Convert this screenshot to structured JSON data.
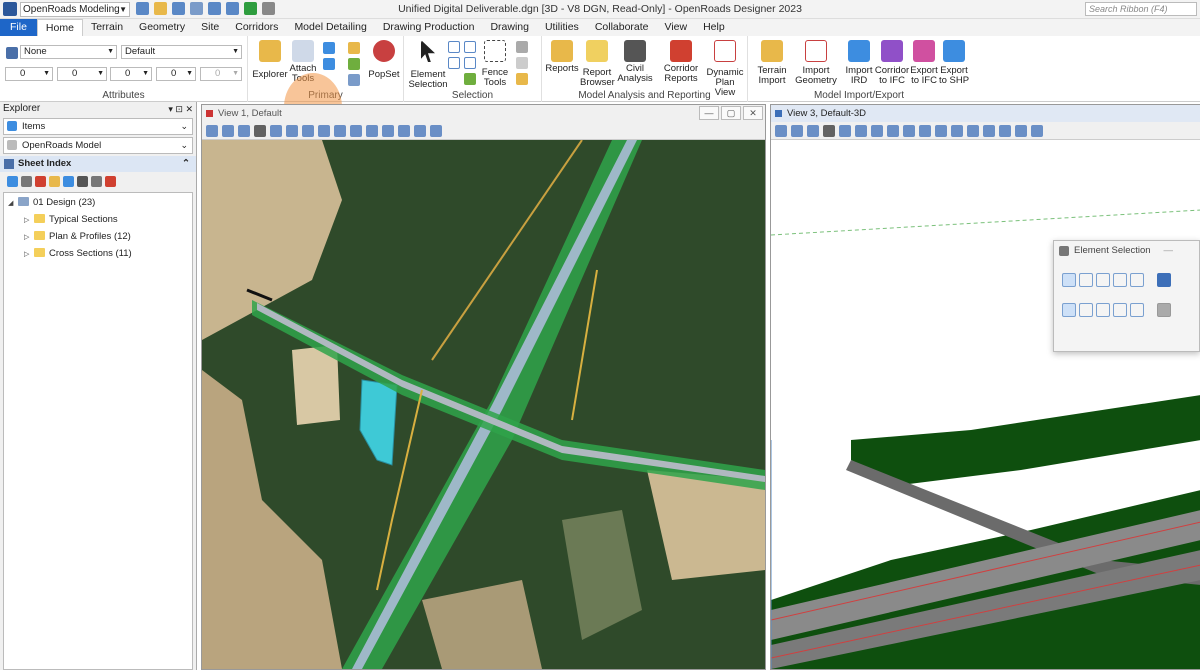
{
  "title_bar": {
    "workspace": "OpenRoads Modeling",
    "doc_title": "Unified Digital Deliverable.dgn [3D - V8 DGN, Read-Only] - OpenRoads Designer 2023",
    "search_placeholder": "Search Ribbon (F4)"
  },
  "tabs": [
    "File",
    "Home",
    "Terrain",
    "Geometry",
    "Site",
    "Corridors",
    "Model Detailing",
    "Drawing Production",
    "Drawing",
    "Utilities",
    "Collaborate",
    "View",
    "Help"
  ],
  "attributes": {
    "level": "None",
    "style": "Default",
    "color": "0",
    "weight": "0",
    "linestyle": "0",
    "transparency": "0",
    "priority": "0",
    "label": "Attributes"
  },
  "primary": {
    "explorer": "Explorer",
    "attach_tools_1": "Attach",
    "attach_tools_2": "Tools",
    "popset": "PopSet",
    "label": "Primary"
  },
  "selection": {
    "element_selection_1": "Element",
    "element_selection_2": "Selection",
    "fence_tools_1": "Fence",
    "fence_tools_2": "Tools",
    "label": "Selection"
  },
  "analysis": {
    "reports": "Reports",
    "report_browser_1": "Report",
    "report_browser_2": "Browser",
    "civil_analysis_1": "Civil",
    "civil_analysis_2": "Analysis",
    "corridor_reports_1": "Corridor",
    "corridor_reports_2": "Reports",
    "dynamic_plan_1": "Dynamic",
    "dynamic_plan_2": "Plan View",
    "label": "Model Analysis and Reporting"
  },
  "import_export": {
    "terrain_import_1": "Terrain",
    "terrain_import_2": "Import",
    "import_geometry_1": "Import",
    "import_geometry_2": "Geometry",
    "import_ird_1": "Import",
    "import_ird_2": "IRD",
    "corridor_ifc_1": "Corridor",
    "corridor_ifc_2": "to IFC",
    "export_ifc_1": "Export",
    "export_ifc_2": "to IFC",
    "export_shp_1": "Export",
    "export_shp_2": "to SHP",
    "label": "Model Import/Export"
  },
  "explorer": {
    "title": "Explorer",
    "items": "Items",
    "openroads_model": "OpenRoads Model",
    "sheet_index": "Sheet Index",
    "tree": {
      "root": "01 Design (23)",
      "children": [
        "Typical Sections",
        "Plan & Profiles (12)",
        "Cross Sections (11)"
      ]
    }
  },
  "view1": {
    "title": "View 1, Default"
  },
  "view3": {
    "title": "View 3, Default-3D"
  },
  "element_selection_panel": {
    "title": "Element Selection"
  },
  "colors": {
    "accent": "#1e66c8",
    "highlight": "#f3964a"
  }
}
